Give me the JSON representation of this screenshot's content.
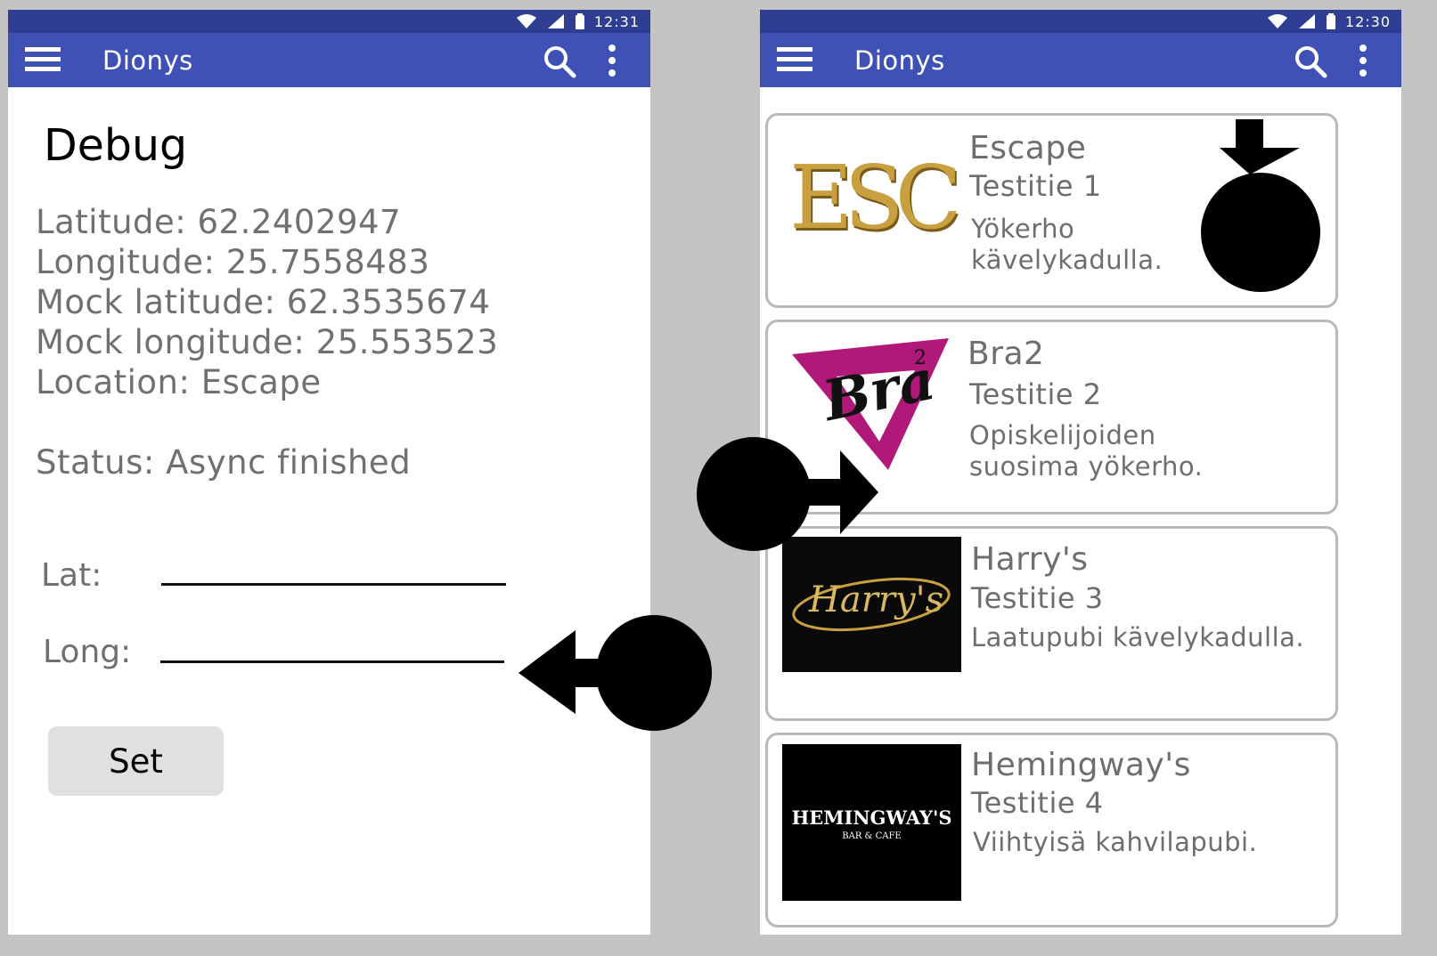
{
  "left_screen": {
    "status_time": "12:31",
    "app_title": "Dionys",
    "icons": {
      "menu": "menu-icon",
      "search": "search-icon",
      "more": "more-vert-icon",
      "wifi": "wifi-icon",
      "signal": "signal-icon",
      "battery": "battery-icon"
    },
    "heading": "Debug",
    "latitude": "Latitude: 62.2402947",
    "longitude": "Longitude: 25.7558483",
    "mock_latitude": "Mock latitude: 62.3535674",
    "mock_longitude": "Mock longitude: 25.553523",
    "location": "Location: Escape",
    "status": "Status: Async finished",
    "lat_label": "Lat:",
    "long_label": "Long:",
    "lat_value": "",
    "long_value": "",
    "set_button": "Set"
  },
  "right_screen": {
    "status_time": "12:30",
    "app_title": "Dionys",
    "venues": [
      {
        "name": "Escape",
        "address": "Testitie 1",
        "description": "Yökerho kävelykadulla.",
        "logo_text": "ESC"
      },
      {
        "name": "Bra2",
        "address": "Testitie 2",
        "description": "Opiskelijoiden suosima yökerho.",
        "logo_text": "Bra",
        "logo_sup": "2"
      },
      {
        "name": "Harry's",
        "address": "Testitie 3",
        "description": "Laatupubi kävelykadulla.",
        "logo_text": "Harry's"
      },
      {
        "name": "Hemingway's",
        "address": "Testitie 4",
        "description": "Viihtyisä kahvilapubi.",
        "logo_text": "HEMINGWAY'S",
        "logo_sub": "BAR & CAFE"
      }
    ]
  },
  "colors": {
    "appbar": "#3f51b5",
    "statusbar": "#2f3e92",
    "background": "#c3c3c3",
    "bra_magenta": "#b0187a",
    "gold": "#c8a040"
  }
}
